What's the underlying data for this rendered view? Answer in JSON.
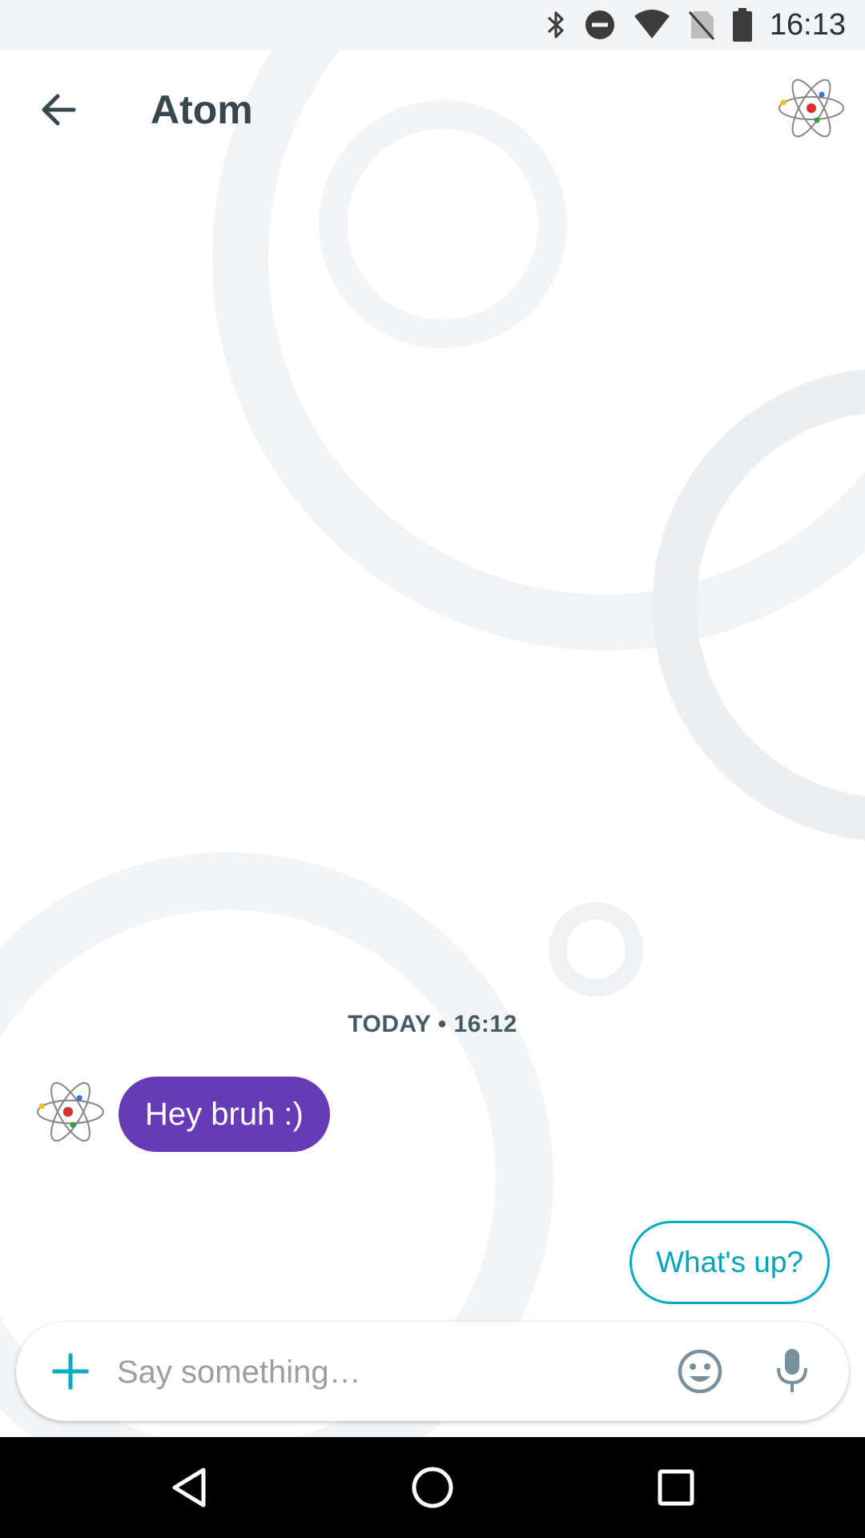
{
  "status_bar": {
    "time": "16:13",
    "icons": [
      "bluetooth-icon",
      "do-not-disturb-icon",
      "wifi-icon",
      "no-sim-icon",
      "battery-icon"
    ]
  },
  "header": {
    "title": "Atom",
    "back_icon": "arrow-back-icon",
    "avatar_icon": "atom-avatar-icon"
  },
  "conversation": {
    "timestamp": "TODAY • 16:12",
    "messages": [
      {
        "sender_avatar": "atom-avatar-icon",
        "text": "Hey bruh :)",
        "bubble_color": "#673ab7"
      }
    ]
  },
  "suggestions": [
    {
      "label": "What's up?"
    }
  ],
  "compose": {
    "placeholder": "Say something…",
    "add_icon": "plus-icon",
    "emoji_icon": "emoji-icon",
    "mic_icon": "mic-icon"
  },
  "nav_bar": {
    "buttons": [
      "back-triangle-icon",
      "home-circle-icon",
      "recents-square-icon"
    ]
  },
  "colors": {
    "accent": "#00acc1",
    "bubble": "#673ab7",
    "status_bar_bg": "#f2f3f5",
    "nav_bar_bg": "#000000"
  }
}
